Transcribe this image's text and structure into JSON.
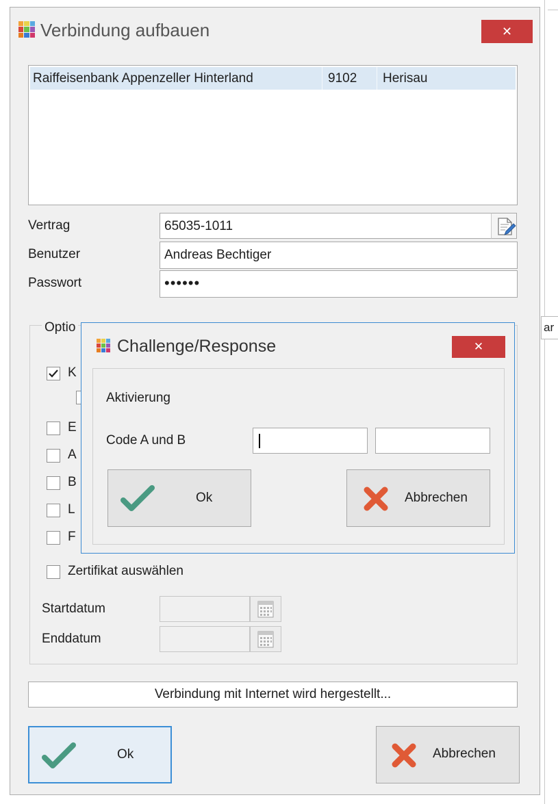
{
  "window": {
    "title": "Verbindung aufbauen",
    "close_glyph": "✕"
  },
  "bank_list": {
    "rows": [
      {
        "name": "Raiffeisenbank Appenzeller Hinterland",
        "code": "9102",
        "place": "Herisau"
      }
    ]
  },
  "form": {
    "contract_label": "Vertrag",
    "contract_value": "65035-1011",
    "user_label": "Benutzer",
    "user_value": "Andreas Bechtiger",
    "password_label": "Passwort",
    "password_value": "••••••"
  },
  "options": {
    "group_title": "Optio",
    "checkboxes": [
      {
        "label": "K",
        "checked": true
      },
      {
        "label": "",
        "checked": false
      },
      {
        "label": "E",
        "checked": false
      },
      {
        "label": "A",
        "checked": false
      },
      {
        "label": "B",
        "checked": false
      },
      {
        "label": "L",
        "checked": false
      },
      {
        "label": "F",
        "checked": false
      },
      {
        "label": "Zertifikat auswählen",
        "checked": false
      }
    ],
    "start_date_label": "Startdatum",
    "end_date_label": "Enddatum"
  },
  "status_text": "Verbindung mit Internet wird hergestellt...",
  "buttons": {
    "ok_label": "Ok",
    "cancel_label": "Abbrechen"
  },
  "dialog": {
    "title": "Challenge/Response",
    "close_glyph": "✕",
    "activation_label": "Aktivierung",
    "code_label": "Code A und B",
    "code_a_value": "",
    "code_b_value": "",
    "ok_label": "Ok",
    "cancel_label": "Abbrechen"
  },
  "background_fragment": "ar",
  "colors": {
    "accent": "#3b8ad2",
    "close_red": "#c83c3c",
    "ok_check_green": "#4a9a82",
    "cancel_x_orange": "#e05a36",
    "selection": "#dbe8f4"
  },
  "icons": {
    "app": "app-grid-icon",
    "close": "close-icon",
    "contract_edit": "edit-document-icon",
    "calendar": "calendar-icon",
    "ok": "checkmark-icon",
    "cancel": "cancel-x-icon"
  }
}
